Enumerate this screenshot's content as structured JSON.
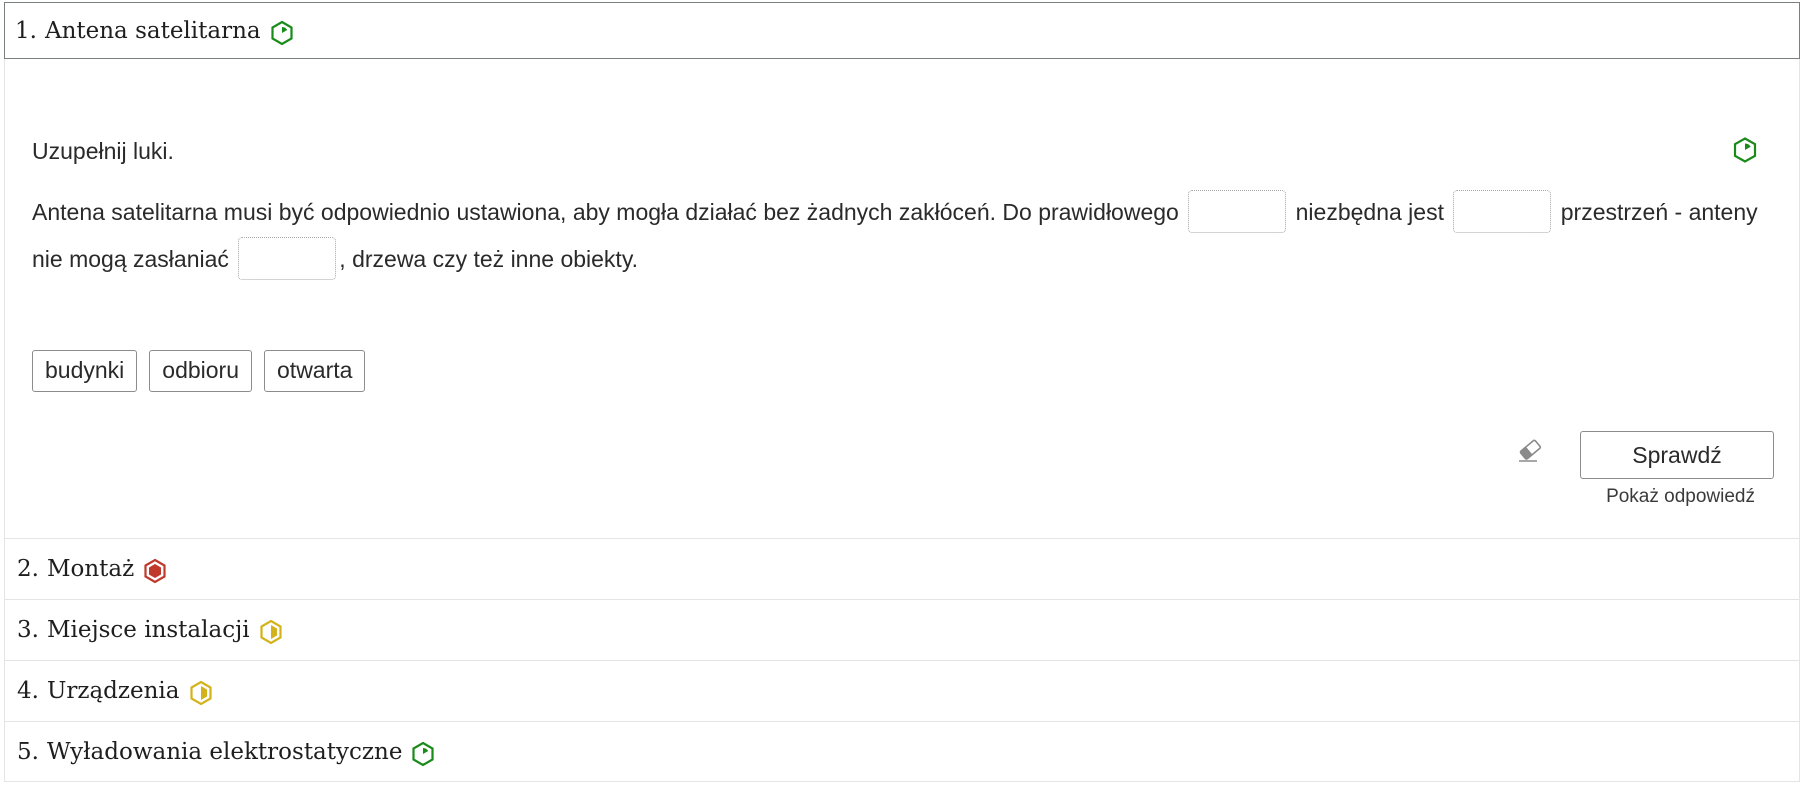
{
  "sections": [
    {
      "num": "1.",
      "title": "Antena satelitarna",
      "status_icon": "play-hexagon-icon",
      "status_color": "#1a8a1a"
    },
    {
      "num": "2.",
      "title": "Montaż",
      "status_icon": "filled-hexagon-icon",
      "status_color": "#c0392b"
    },
    {
      "num": "3.",
      "title": "Miejsce instalacji",
      "status_icon": "half-hexagon-icon",
      "status_color": "#d4b21a"
    },
    {
      "num": "4.",
      "title": "Urządzenia",
      "status_icon": "half-hexagon-icon",
      "status_color": "#d4b21a"
    },
    {
      "num": "5.",
      "title": "Wyładowania elektrostatyczne",
      "status_icon": "play-hexagon-icon",
      "status_color": "#1a8a1a"
    }
  ],
  "exercise": {
    "instruction": "Uzupełnij luki.",
    "status_icon": "play-hexagon-icon",
    "text_parts": [
      "Antena satelitarna musi być odpowiednio ustawiona, aby mogła działać bez żadnych zakłóceń. Do prawidłowego",
      "niezbędna jest",
      "przestrzeń - anteny nie mogą zasłaniać",
      ", drzewa czy też inne obiekty."
    ],
    "gaps": [
      "",
      "",
      ""
    ],
    "chips": [
      "budynki",
      "odbioru",
      "otwarta"
    ],
    "eraser_icon": "eraser-icon",
    "check_label": "Sprawdź",
    "show_answer_label": "Pokaż odpowiedź"
  }
}
